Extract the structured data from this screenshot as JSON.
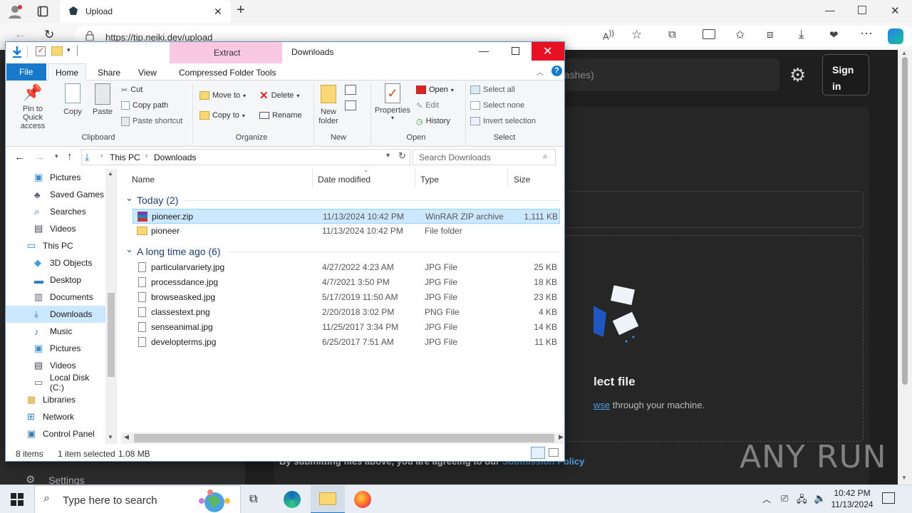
{
  "browser": {
    "tab_title": "Upload",
    "url": "https://tip.neiki.dev/upload",
    "window_controls": [
      "minimize-icon",
      "restore-icon",
      "close-icon"
    ]
  },
  "webpage": {
    "search_placeholder": "hashes)",
    "sign_in": "Sign\nin",
    "select_file": "lect file",
    "browse_link": "wse",
    "browse_rest": " through your machine.",
    "policy_prefix": "By submitting files above, you are agreeing to our ",
    "policy_link": "Submission Policy",
    "settings_label": "Settings",
    "watermark": "ANY RUN"
  },
  "explorer": {
    "title": "Downloads",
    "context_tab_header": "Extract",
    "tabs": [
      "File",
      "Home",
      "Share",
      "View",
      "Compressed Folder Tools"
    ],
    "ribbon": {
      "clipboard": {
        "label": "Clipboard",
        "pin": "Pin to Quick access",
        "copy": "Copy",
        "paste": "Paste",
        "cut": "Cut",
        "copy_path": "Copy path",
        "paste_shortcut": "Paste shortcut"
      },
      "organize": {
        "label": "Organize",
        "move_to": "Move to",
        "copy_to": "Copy to",
        "delete": "Delete",
        "rename": "Rename"
      },
      "new": {
        "label": "New",
        "new_folder": "New folder"
      },
      "open": {
        "label": "Open",
        "properties": "Properties",
        "open": "Open",
        "edit": "Edit",
        "history": "History"
      },
      "select": {
        "label": "Select",
        "select_all": "Select all",
        "select_none": "Select none",
        "invert": "Invert selection"
      }
    },
    "breadcrumb": [
      "This PC",
      "Downloads"
    ],
    "search_placeholder": "Search Downloads",
    "nav": [
      {
        "label": "Pictures",
        "icon": "pictures-icon",
        "indent": 1
      },
      {
        "label": "Saved Games",
        "icon": "saved-games-icon",
        "indent": 1
      },
      {
        "label": "Searches",
        "icon": "searches-icon",
        "indent": 1
      },
      {
        "label": "Videos",
        "icon": "videos-icon",
        "indent": 1
      },
      {
        "label": "This PC",
        "icon": "this-pc-icon",
        "indent": 0
      },
      {
        "label": "3D Objects",
        "icon": "3d-objects-icon",
        "indent": 1
      },
      {
        "label": "Desktop",
        "icon": "desktop-icon",
        "indent": 1
      },
      {
        "label": "Documents",
        "icon": "documents-icon",
        "indent": 1
      },
      {
        "label": "Downloads",
        "icon": "downloads-icon",
        "indent": 1,
        "selected": true
      },
      {
        "label": "Music",
        "icon": "music-icon",
        "indent": 1
      },
      {
        "label": "Pictures",
        "icon": "pictures-icon",
        "indent": 1
      },
      {
        "label": "Videos",
        "icon": "videos-icon",
        "indent": 1
      },
      {
        "label": "Local Disk (C:)",
        "icon": "disk-icon",
        "indent": 1
      },
      {
        "label": "Libraries",
        "icon": "libraries-icon",
        "indent": 0
      },
      {
        "label": "Network",
        "icon": "network-icon",
        "indent": 0
      },
      {
        "label": "Control Panel",
        "icon": "control-panel-icon",
        "indent": 0
      }
    ],
    "columns": [
      "Name",
      "Date modified",
      "Type",
      "Size"
    ],
    "groups": [
      {
        "header": "Today (2)",
        "files": [
          {
            "name": "pioneer.zip",
            "date": "11/13/2024 10:42 PM",
            "type": "WinRAR ZIP archive",
            "size": "1,111 KB",
            "icon": "zip-icon",
            "selected": true
          },
          {
            "name": "pioneer",
            "date": "11/13/2024 10:42 PM",
            "type": "File folder",
            "size": "",
            "icon": "folder-icon"
          }
        ]
      },
      {
        "header": "A long time ago (6)",
        "files": [
          {
            "name": "particularvariety.jpg",
            "date": "4/27/2022 4:23 AM",
            "type": "JPG File",
            "size": "25 KB",
            "icon": "image-file-icon"
          },
          {
            "name": "processdance.jpg",
            "date": "4/7/2021 3:50 PM",
            "type": "JPG File",
            "size": "18 KB",
            "icon": "image-file-icon"
          },
          {
            "name": "browseasked.jpg",
            "date": "5/17/2019 11:50 AM",
            "type": "JPG File",
            "size": "23 KB",
            "icon": "image-file-icon"
          },
          {
            "name": "classestext.png",
            "date": "2/20/2018 3:02 PM",
            "type": "PNG File",
            "size": "4 KB",
            "icon": "image-file-icon"
          },
          {
            "name": "senseanimal.jpg",
            "date": "11/25/2017 3:34 PM",
            "type": "JPG File",
            "size": "14 KB",
            "icon": "image-file-icon"
          },
          {
            "name": "developterms.jpg",
            "date": "6/25/2017 7:51 AM",
            "type": "JPG File",
            "size": "11 KB",
            "icon": "image-file-icon"
          }
        ]
      }
    ],
    "status": {
      "count": "8 items",
      "selection": "1 item selected",
      "size": "1.08 MB"
    }
  },
  "taskbar": {
    "search_placeholder": "Type here to search",
    "time": "10:42 PM",
    "date": "11/13/2024"
  },
  "colors": {
    "accent": "#1979ca",
    "selection": "#cce8ff",
    "extract_tab": "#f9c9e4",
    "close_red": "#e81123"
  }
}
